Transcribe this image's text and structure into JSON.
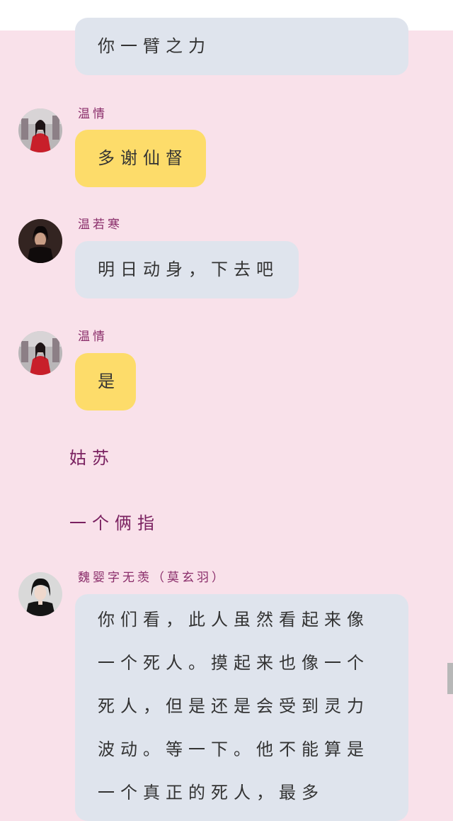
{
  "messages": [
    {
      "type": "bubble",
      "speaker": "",
      "text": "你一臂之力",
      "color": "#dfe4ed"
    },
    {
      "type": "bubble",
      "speaker": "温情",
      "text": "多谢仙督",
      "color": "#fddc6a"
    },
    {
      "type": "bubble",
      "speaker": "温若寒",
      "text": "明日动身，下去吧",
      "color": "#dfe4ed"
    },
    {
      "type": "bubble",
      "speaker": "温情",
      "text": "是",
      "color": "#fddc6a"
    },
    {
      "type": "narration",
      "text": "姑苏"
    },
    {
      "type": "narration",
      "text": "一个俩指"
    },
    {
      "type": "bubble",
      "speaker": "魏婴字无羡（莫玄羽）",
      "lines": [
        "你们看，此人虽然看起来像",
        "一个死人。摸起来也像一个",
        "死人，但是还是会受到灵力",
        "波动。等一下。他不能算是",
        "一个真正的死人，最多"
      ],
      "color": "#dfe4ed"
    }
  ],
  "avatars": {
    "wenqing": "woman-in-red-avatar",
    "wenruohan": "man-in-black-avatar",
    "weiying": "young-man-avatar"
  }
}
